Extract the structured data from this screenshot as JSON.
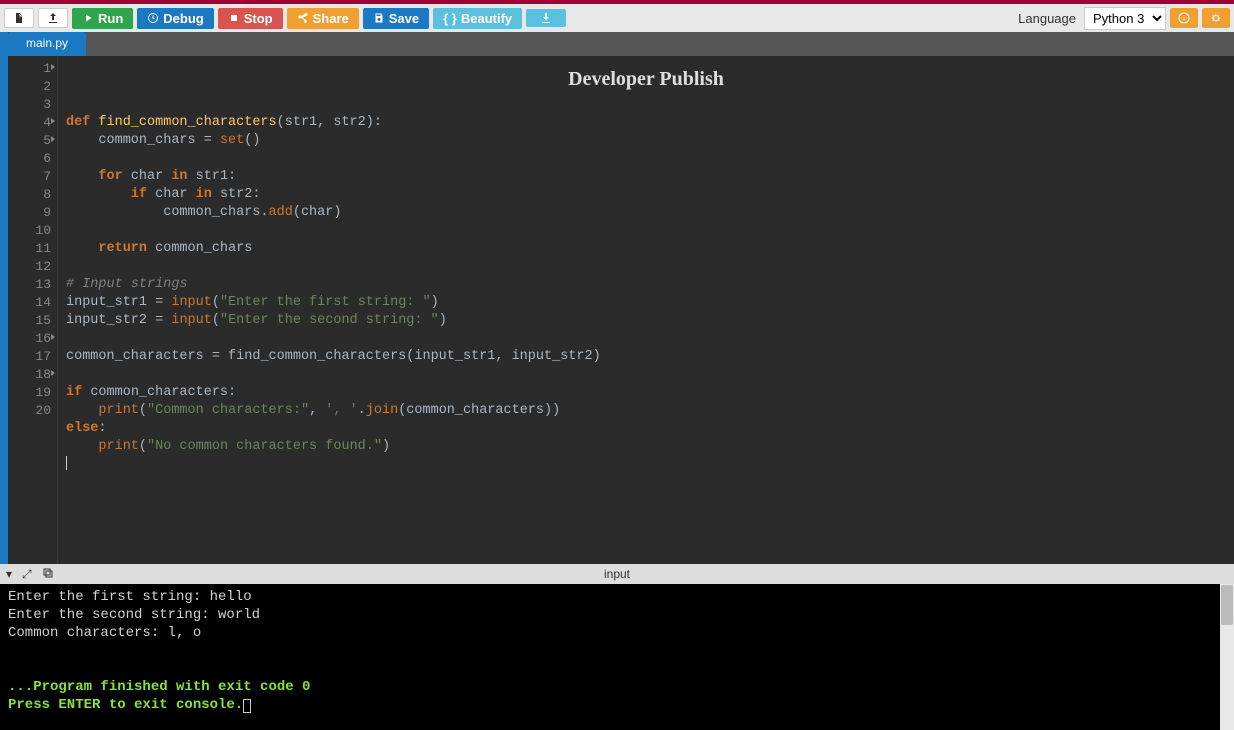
{
  "toolbar": {
    "run": "Run",
    "debug": "Debug",
    "stop": "Stop",
    "share": "Share",
    "save": "Save",
    "beautify": "Beautify"
  },
  "language": {
    "label": "Language",
    "selected": "Python 3"
  },
  "tab": {
    "name": "main.py"
  },
  "watermark": "Developer Publish",
  "code": {
    "lines": [
      {
        "n": 1,
        "fold": true,
        "tokens": [
          {
            "t": "def ",
            "c": "kw"
          },
          {
            "t": "find_common_characters",
            "c": "fn-name"
          },
          {
            "t": "(str1, str2):",
            "c": "var"
          }
        ]
      },
      {
        "n": 2,
        "tokens": [
          {
            "t": "    common_chars ",
            "c": "var"
          },
          {
            "t": "=",
            "c": "op"
          },
          {
            "t": " ",
            "c": "var"
          },
          {
            "t": "set",
            "c": "builtin"
          },
          {
            "t": "()",
            "c": "var"
          }
        ]
      },
      {
        "n": 3,
        "tokens": []
      },
      {
        "n": 4,
        "fold": true,
        "tokens": [
          {
            "t": "    ",
            "c": "var"
          },
          {
            "t": "for ",
            "c": "kw"
          },
          {
            "t": "char ",
            "c": "var"
          },
          {
            "t": "in ",
            "c": "kw"
          },
          {
            "t": "str1:",
            "c": "var"
          }
        ]
      },
      {
        "n": 5,
        "fold": true,
        "tokens": [
          {
            "t": "        ",
            "c": "var"
          },
          {
            "t": "if ",
            "c": "kw"
          },
          {
            "t": "char ",
            "c": "var"
          },
          {
            "t": "in ",
            "c": "kw"
          },
          {
            "t": "str2:",
            "c": "var"
          }
        ]
      },
      {
        "n": 6,
        "tokens": [
          {
            "t": "            common_chars.",
            "c": "var"
          },
          {
            "t": "add",
            "c": "builtin"
          },
          {
            "t": "(char)",
            "c": "var"
          }
        ]
      },
      {
        "n": 7,
        "tokens": []
      },
      {
        "n": 8,
        "tokens": [
          {
            "t": "    ",
            "c": "var"
          },
          {
            "t": "return ",
            "c": "kw"
          },
          {
            "t": "common_chars",
            "c": "var"
          }
        ]
      },
      {
        "n": 9,
        "tokens": []
      },
      {
        "n": 10,
        "tokens": [
          {
            "t": "# Input strings",
            "c": "cmt"
          }
        ]
      },
      {
        "n": 11,
        "tokens": [
          {
            "t": "input_str1 ",
            "c": "var"
          },
          {
            "t": "=",
            "c": "op"
          },
          {
            "t": " ",
            "c": "var"
          },
          {
            "t": "input",
            "c": "builtin"
          },
          {
            "t": "(",
            "c": "var"
          },
          {
            "t": "\"Enter the first string: \"",
            "c": "str"
          },
          {
            "t": ")",
            "c": "var"
          }
        ]
      },
      {
        "n": 12,
        "tokens": [
          {
            "t": "input_str2 ",
            "c": "var"
          },
          {
            "t": "=",
            "c": "op"
          },
          {
            "t": " ",
            "c": "var"
          },
          {
            "t": "input",
            "c": "builtin"
          },
          {
            "t": "(",
            "c": "var"
          },
          {
            "t": "\"Enter the second string: \"",
            "c": "str"
          },
          {
            "t": ")",
            "c": "var"
          }
        ]
      },
      {
        "n": 13,
        "tokens": []
      },
      {
        "n": 14,
        "tokens": [
          {
            "t": "common_characters ",
            "c": "var"
          },
          {
            "t": "=",
            "c": "op"
          },
          {
            "t": " find_common_characters(input_str1, input_str2)",
            "c": "var"
          }
        ]
      },
      {
        "n": 15,
        "tokens": []
      },
      {
        "n": 16,
        "fold": true,
        "tokens": [
          {
            "t": "if ",
            "c": "kw"
          },
          {
            "t": "common_characters:",
            "c": "var"
          }
        ]
      },
      {
        "n": 17,
        "tokens": [
          {
            "t": "    ",
            "c": "var"
          },
          {
            "t": "print",
            "c": "builtin"
          },
          {
            "t": "(",
            "c": "var"
          },
          {
            "t": "\"Common characters:\"",
            "c": "str"
          },
          {
            "t": ", ",
            "c": "var"
          },
          {
            "t": "', '",
            "c": "str"
          },
          {
            "t": ".",
            "c": "var"
          },
          {
            "t": "join",
            "c": "builtin"
          },
          {
            "t": "(common_characters))",
            "c": "var"
          }
        ]
      },
      {
        "n": 18,
        "fold": true,
        "tokens": [
          {
            "t": "else",
            "c": "kw"
          },
          {
            "t": ":",
            "c": "var"
          }
        ]
      },
      {
        "n": 19,
        "tokens": [
          {
            "t": "    ",
            "c": "var"
          },
          {
            "t": "print",
            "c": "builtin"
          },
          {
            "t": "(",
            "c": "var"
          },
          {
            "t": "\"No common characters found.\"",
            "c": "str"
          },
          {
            "t": ")",
            "c": "var"
          }
        ]
      },
      {
        "n": 20,
        "tokens": []
      }
    ]
  },
  "divider": {
    "label": "input"
  },
  "console": {
    "plain": [
      "Enter the first string: hello",
      "Enter the second string: world",
      "Common characters: l, o",
      "",
      ""
    ],
    "green": [
      "...Program finished with exit code 0",
      "Press ENTER to exit console."
    ]
  }
}
